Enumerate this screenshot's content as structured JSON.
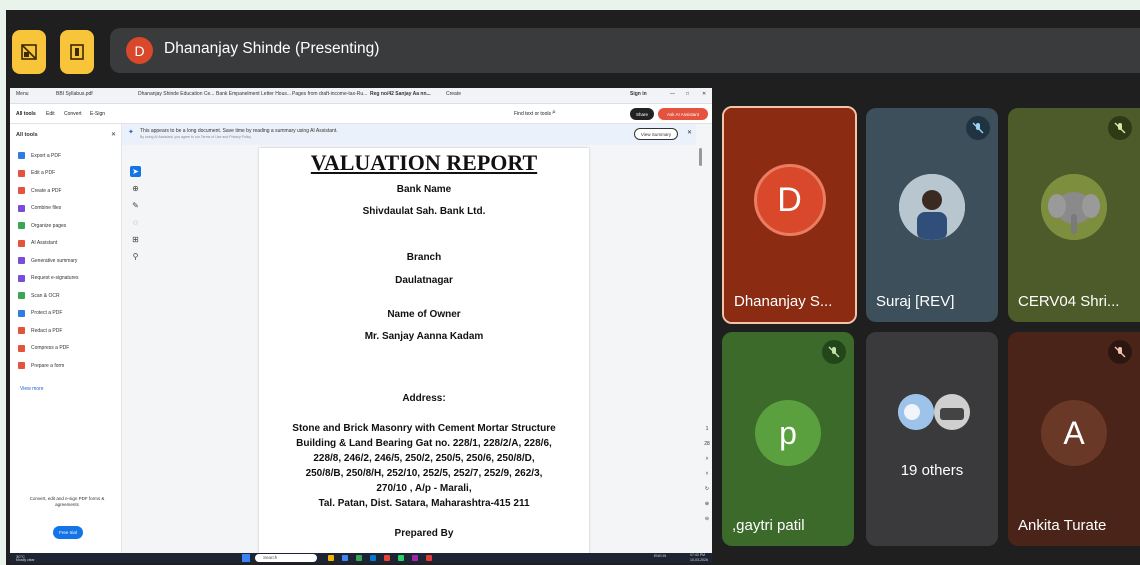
{
  "meet": {
    "presenter_initial": "D",
    "presenter_label": "Dhananjay Shinde (Presenting)"
  },
  "browser": {
    "tabs": [
      "Menu",
      "BBI Syllabus.pdf",
      "Dhananjay Shinde Education Ce...",
      "Bank Empanelment Letter Hous...",
      "Pages from draft-income-tax-Ru...",
      "Reg no/42 Sanjay Aa nn...",
      "Create"
    ],
    "sign_in": "Sign in"
  },
  "acrobat": {
    "menu": [
      "All tools",
      "Edit",
      "Convert",
      "E-Sign"
    ],
    "search_hint": "Find text or tools",
    "share": "Share",
    "ai_assistant": "Ask AI Assistant",
    "panel_title": "All tools",
    "tools": [
      {
        "label": "Export a PDF",
        "color": "#2f7de1"
      },
      {
        "label": "Edit a PDF",
        "color": "#e5533f"
      },
      {
        "label": "Create a PDF",
        "color": "#e5533f"
      },
      {
        "label": "Combine files",
        "color": "#7a4ed9"
      },
      {
        "label": "Organize pages",
        "color": "#3aa655"
      },
      {
        "label": "AI Assistant",
        "color": "#e5533f"
      },
      {
        "label": "Generative summary",
        "color": "#7a4ed9"
      },
      {
        "label": "Request e-signatures",
        "color": "#7a4ed9"
      },
      {
        "label": "Scan & OCR",
        "color": "#3aa655"
      },
      {
        "label": "Protect a PDF",
        "color": "#2f7de1"
      },
      {
        "label": "Redact a PDF",
        "color": "#e5533f"
      },
      {
        "label": "Compress a PDF",
        "color": "#e5533f"
      },
      {
        "label": "Prepare a form",
        "color": "#e5533f"
      }
    ],
    "view_more": "View more",
    "promo": "Convert, edit and e-sign PDF forms & agreements",
    "free_trial": "Free trial",
    "banner": "This appears to be a long document. Save time by reading a summary using AI Assistant.",
    "banner_sub": "By using AI Assistant, you agree to our Terms of Use and Privacy Policy",
    "view_summary": "View Summary",
    "page_num": "1",
    "page_total": "28"
  },
  "document": {
    "title": "VALUATION REPORT",
    "bank_label": "Bank Name",
    "bank_name": "Shivdaulat Sah. Bank Ltd.",
    "branch_label": "Branch",
    "branch_name": "Daulatnagar",
    "owner_label": "Name of Owner",
    "owner_name": "Mr. Sanjay Aanna Kadam",
    "address_label": "Address:",
    "address_lines": [
      "Stone and Brick Masonry with Cement Mortar Structure",
      "Building & Land Bearing Gat no.  228/1, 228/2/A, 228/6,",
      "228/8, 246/2, 246/5, 250/2, 250/5, 250/6, 250/8/D,",
      "250/8/B, 250/8/H, 252/10, 252/5, 252/7, 252/9, 262/3,",
      "270/10 , A/p - Marali,",
      "Tal. Patan, Dist. Satara, Maharashtra-415 211"
    ],
    "prepared_by": "Prepared By"
  },
  "taskbar": {
    "weather_temp": "30°C",
    "weather_desc": "Mostly clear",
    "search": "Search",
    "lang": "ENG IN",
    "time": "07:43 PM",
    "date": "10-03-2026"
  },
  "participants": [
    {
      "name": "Dhananjay S...",
      "initial": "D",
      "bg": "#8a2b12",
      "muted": false
    },
    {
      "name": "Suraj [REV]",
      "initial": "",
      "bg": "#3d4f5a",
      "muted": true
    },
    {
      "name": "CERV04 Shri...",
      "initial": "",
      "bg": "#4d5a2a",
      "muted": true
    },
    {
      "name": ",gaytri patil",
      "initial": "p",
      "bg": "#3b6a2a",
      "muted": true
    },
    {
      "name": "19 others",
      "initial": "",
      "bg": "#3a3a3c",
      "muted": false
    },
    {
      "name": "Ankita Turate",
      "initial": "A",
      "bg": "#4a2418",
      "muted": true
    }
  ]
}
